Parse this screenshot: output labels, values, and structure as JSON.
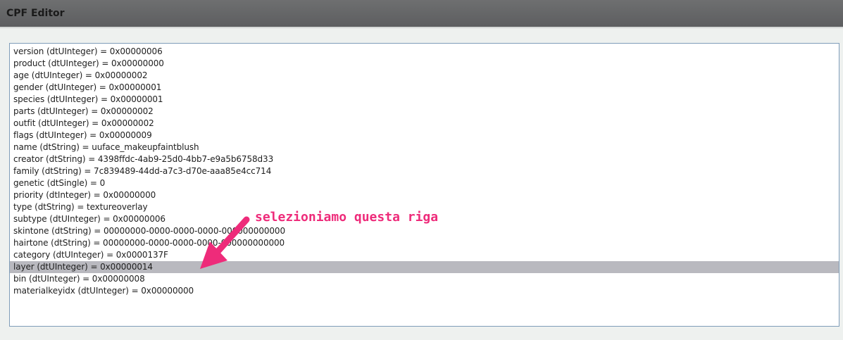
{
  "window": {
    "title": "CPF Editor"
  },
  "list": {
    "rows": [
      "version (dtUInteger) = 0x00000006",
      "product (dtUInteger) = 0x00000000",
      "age (dtUInteger) = 0x00000002",
      "gender (dtUInteger) = 0x00000001",
      "species (dtUInteger) = 0x00000001",
      "parts (dtUInteger) = 0x00000002",
      "outfit (dtUInteger) = 0x00000002",
      "flags (dtUInteger) = 0x00000009",
      "name (dtString) = uuface_makeupfaintblush",
      "creator (dtString) = 4398ffdc-4ab9-25d0-4bb7-e9a5b6758d33",
      "family (dtString) = 7c839489-44dd-a7c3-d70e-aaa85e4cc714",
      "genetic (dtSingle) = 0",
      "priority (dtInteger) = 0x00000000",
      "type (dtString) = textureoverlay",
      "subtype (dtUInteger) = 0x00000006",
      "skintone (dtString) = 00000000-0000-0000-0000-000000000000",
      "hairtone (dtString) = 00000000-0000-0000-0000-000000000000",
      "category (dtUInteger) = 0x0000137F",
      "layer (dtUInteger) = 0x00000014",
      "bin (dtUInteger) = 0x00000008",
      "materialkeyidx (dtUInteger) = 0x00000000"
    ],
    "selected_index": 18
  },
  "annotation": {
    "text": "selezioniamo questa riga",
    "color": "#ee2b7a"
  }
}
